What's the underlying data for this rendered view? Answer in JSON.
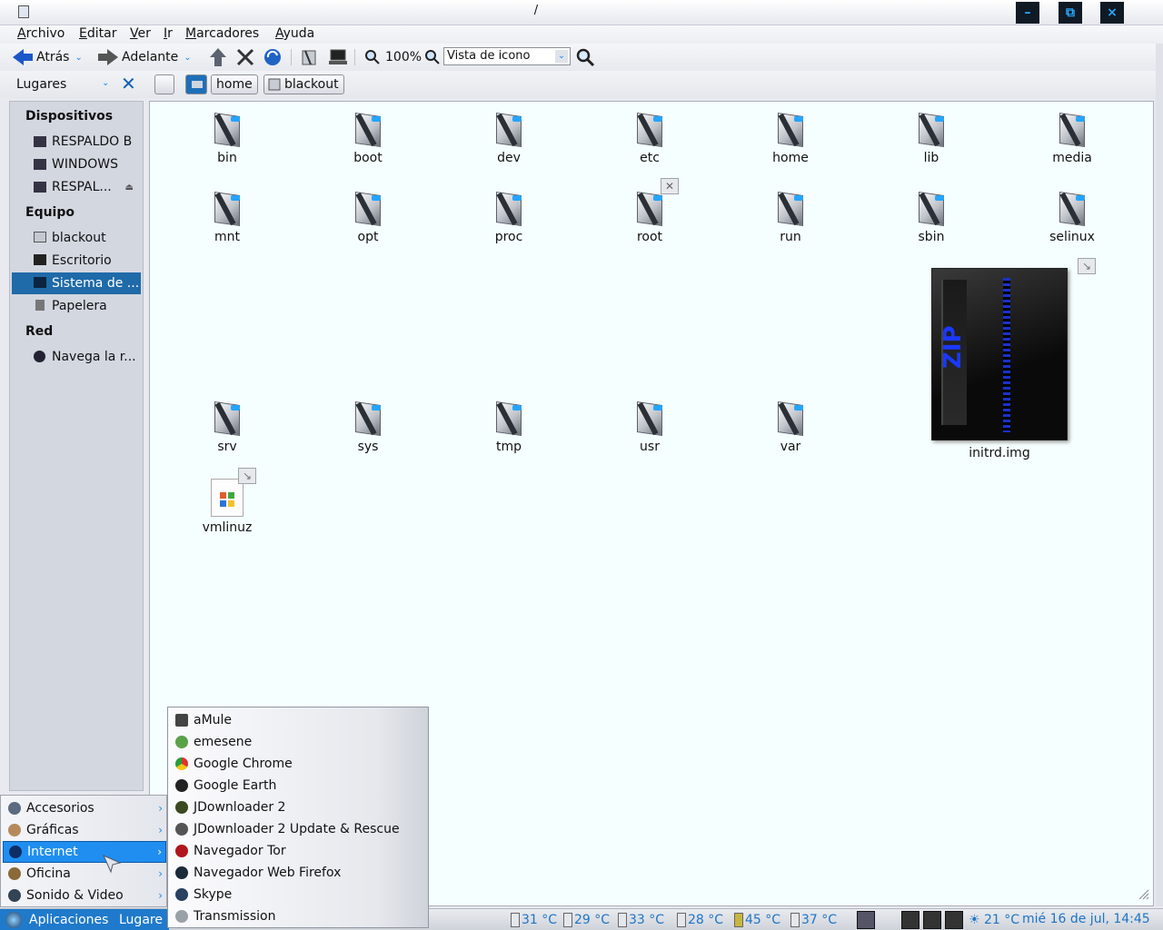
{
  "window": {
    "title": "/",
    "buttons": {
      "minimize": "–",
      "maximize": "⧉",
      "close": "×"
    }
  },
  "menubar": [
    "Archivo",
    "Editar",
    "Ver",
    "Ir",
    "Marcadores",
    "Ayuda"
  ],
  "toolbar": {
    "back": "Atrás",
    "forward": "Adelante",
    "zoom": "100%",
    "view_mode": "Vista de icono"
  },
  "location": {
    "places_label": "Lugares",
    "crumbs": [
      "home",
      "blackout"
    ]
  },
  "sidebar": {
    "sections": [
      {
        "title": "Dispositivos",
        "items": [
          "RESPALDO B",
          "WINDOWS",
          "RESPAL..."
        ]
      },
      {
        "title": "Equipo",
        "items": [
          "blackout",
          "Escritorio",
          "Sistema de ...",
          "Papelera"
        ]
      },
      {
        "title": "Red",
        "items": [
          "Navega la r..."
        ]
      }
    ],
    "selected": "Sistema de ..."
  },
  "files": {
    "row1": [
      "bin",
      "boot",
      "dev",
      "etc",
      "home",
      "lib",
      "media"
    ],
    "row2": [
      "mnt",
      "opt",
      "proc",
      "root",
      "run",
      "sbin",
      "selinux"
    ],
    "row3": [
      "srv",
      "sys",
      "tmp",
      "usr",
      "var"
    ],
    "initrd": "initrd.img",
    "vmlinuz": "vmlinuz",
    "zip_text": "ZIP"
  },
  "app_menu": {
    "categories": [
      "Accesorios",
      "Gráficas",
      "Internet",
      "Oficina",
      "Sonido & Video"
    ],
    "active": "Internet",
    "internet_items": [
      "aMule",
      "emesene",
      "Google Chrome",
      "Google Earth",
      "JDownloader 2",
      "JDownloader 2 Update & Rescue",
      "Navegador Tor",
      "Navegador Web Firefox",
      "Skype",
      "Transmission"
    ]
  },
  "taskbar": {
    "apps_label": "Aplicaciones",
    "places_label": "Lugare",
    "temps": [
      "31 °C",
      "29 °C",
      "33 °C",
      "28 °C",
      "45 °C",
      "37 °C"
    ],
    "weather": "21 °C",
    "clock": "mié 16 de jul, 14:45"
  },
  "colors": {
    "accent": "#1f7acb",
    "selection": "#1f6aa8",
    "menu_active": "#1f8ef0",
    "tray_text": "#1d74c7"
  }
}
